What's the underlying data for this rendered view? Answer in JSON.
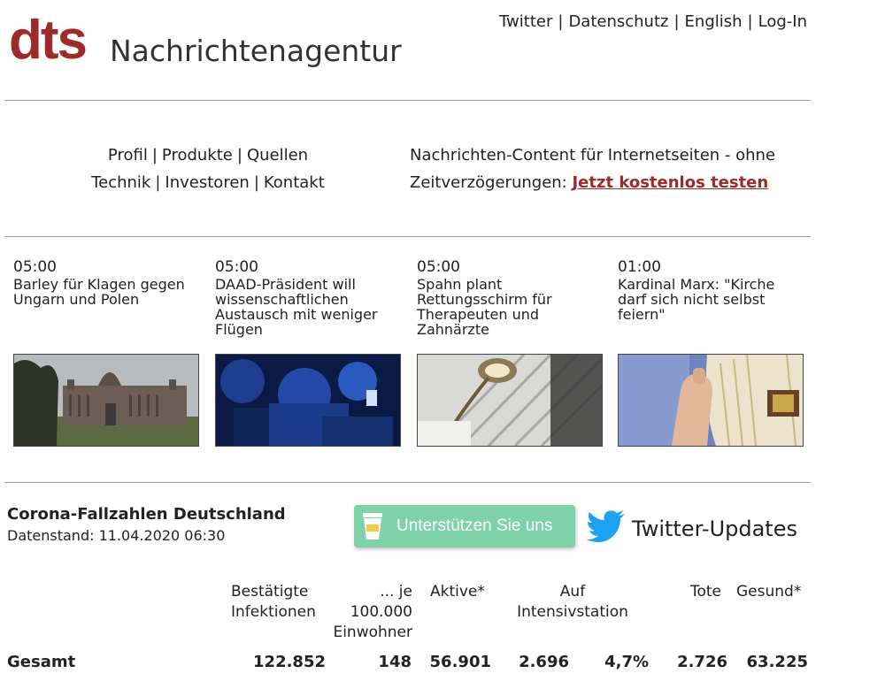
{
  "header": {
    "logo": "dts",
    "site_name": "Nachrichtenagentur",
    "top_links": [
      "Twitter",
      "Datenschutz",
      "English",
      "Log-In"
    ]
  },
  "site_nav": {
    "row1": [
      "Profil",
      "Produkte",
      "Quellen"
    ],
    "row2": [
      "Technik",
      "Investoren",
      "Kontakt"
    ]
  },
  "promo": {
    "text": "Nachrichten-Content für Internetseiten - ohne Zeitverzögerungen:",
    "link": "Jetzt kostenlos testen"
  },
  "news": [
    {
      "time": "05:00",
      "title": "Barley für Klagen gegen Ungarn und Polen",
      "image": "parliament-building-photo"
    },
    {
      "time": "05:00",
      "title": "DAAD-Präsident will wissenschaftlichen Austausch mit weniger Flügen",
      "image": "crowd-with-phones-photo"
    },
    {
      "time": "05:00",
      "title": "Spahn plant Rettungsschirm für Therapeuten und Zahnärzte",
      "image": "dental-lamp-photo"
    },
    {
      "time": "01:00",
      "title": "Kardinal Marx: \"Kirche darf sich nicht selbst feiern\"",
      "image": "cardinal-vestment-photo"
    }
  ],
  "corona": {
    "title": "Corona-Fallzahlen Deutschland",
    "date": "Datenstand: 11.04.2020 06:30",
    "support_label": "Unterstützen Sie uns",
    "twitter_label": "Twitter-Updates",
    "headers": {
      "confirmed_1": "Bestätigte",
      "confirmed_2": "Infektionen",
      "per100k_1": "... je",
      "per100k_2": "100.000",
      "per100k_3": "Einwohner",
      "active": "Aktive*",
      "icu_1": "Auf",
      "icu_2": "Intensivstation",
      "deaths": "Tote",
      "recovered": "Gesund*"
    },
    "total": {
      "label": "Gesamt",
      "confirmed": "122.852",
      "per100k": "148",
      "active": "56.901",
      "icu": "2.696",
      "icu_pct": "4,7%",
      "deaths": "2.726",
      "recovered": "63.225"
    }
  },
  "colors": {
    "brand": "#9e2a2b",
    "support_button": "#7fd1a8",
    "twitter": "#1da1f2"
  }
}
